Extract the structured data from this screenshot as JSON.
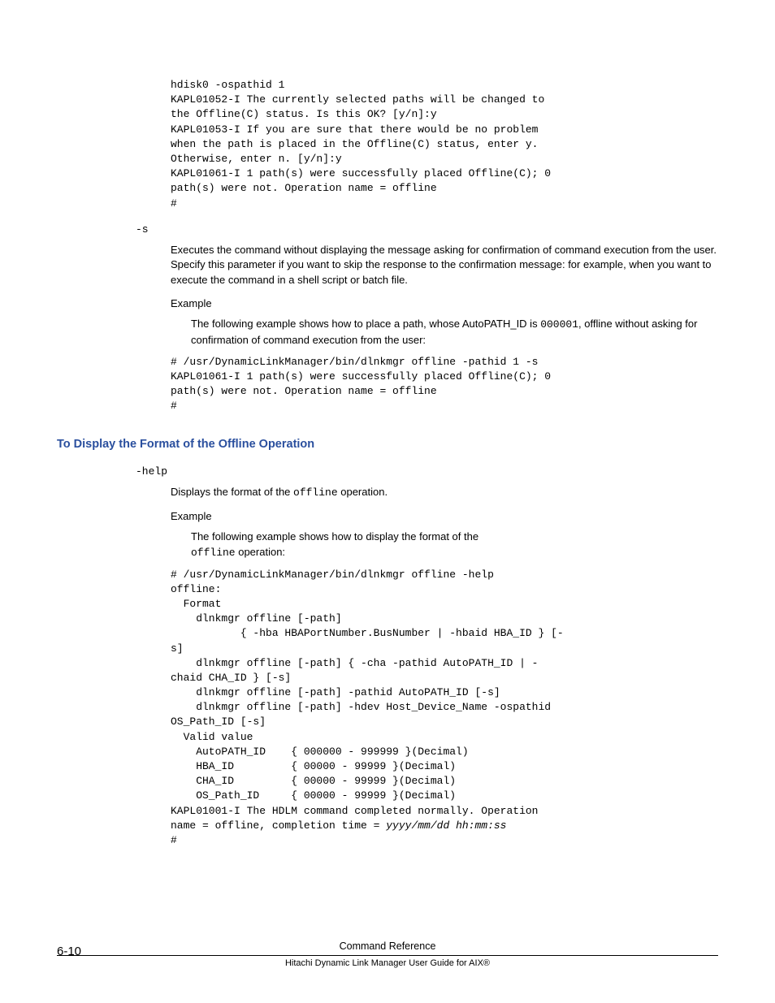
{
  "code1": "hdisk0 -ospathid 1\nKAPL01052-I The currently selected paths will be changed to\nthe Offline(C) status. Is this OK? [y/n]:y\nKAPL01053-I If you are sure that there would be no problem\nwhen the path is placed in the Offline(C) status, enter y.\nOtherwise, enter n. [y/n]:y\nKAPL01061-I 1 path(s) were successfully placed Offline(C); 0\npath(s) were not. Operation name = offline\n#",
  "opt_s": "-s",
  "s_desc": "Executes the command without displaying the message asking for confirmation of command execution from the user. Specify this parameter if you want to skip the response to the confirmation message: for example, when you want to execute the command in a shell script or batch file.",
  "example_label": "Example",
  "s_example_pre": "The following example shows how to place a path, whose AutoPATH_ID is ",
  "s_example_code_inline": "000001",
  "s_example_post": ", offline without asking for confirmation of command execution from the user:",
  "code2": "# /usr/DynamicLinkManager/bin/dlnkmgr offline -pathid 1 -s\nKAPL01061-I 1 path(s) were successfully placed Offline(C); 0\npath(s) were not. Operation name = offline\n#",
  "heading2": "To Display the Format of the Offline Operation",
  "opt_help": "-help",
  "help_desc_pre": "Displays the format of the ",
  "help_desc_code": "offline",
  "help_desc_post": " operation.",
  "help_example_line1": "The following example shows how to display the format of the ",
  "help_example_line2_code": "offline",
  "help_example_line2_post": " operation:",
  "code3_pre": "# /usr/DynamicLinkManager/bin/dlnkmgr offline -help\noffline:\n  Format\n    dlnkmgr offline [-path]\n           { -hba HBAPortNumber.BusNumber | -hbaid HBA_ID } [-\ns]\n    dlnkmgr offline [-path] { -cha -pathid AutoPATH_ID | -\nchaid CHA_ID } [-s]\n    dlnkmgr offline [-path] -pathid AutoPATH_ID [-s]\n    dlnkmgr offline [-path] -hdev Host_Device_Name -ospathid\nOS_Path_ID [-s]\n  Valid value\n    AutoPATH_ID    { 000000 - 999999 }(Decimal)\n    HBA_ID         { 00000 - 99999 }(Decimal)\n    CHA_ID         { 00000 - 99999 }(Decimal)\n    OS_Path_ID     { 00000 - 99999 }(Decimal)\nKAPL01001-I The HDLM command completed normally. Operation\nname = offline, completion time = ",
  "code3_time": "yyyy/mm/dd hh:mm:ss",
  "code3_post": "\n#",
  "footer_top": "Command Reference",
  "footer_bottom": "Hitachi Dynamic Link Manager User Guide for AIX®",
  "page_num": "6-10"
}
